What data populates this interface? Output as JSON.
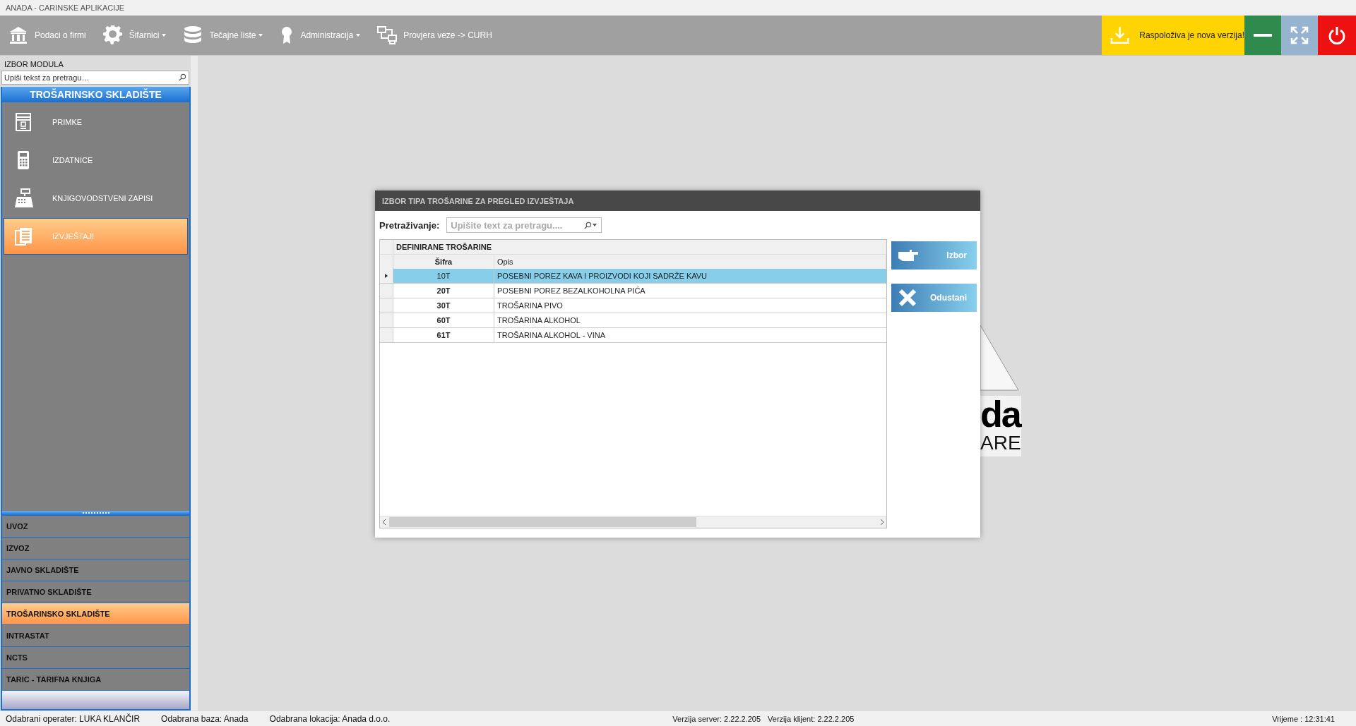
{
  "window": {
    "title": "ANADA - CARINSKE APLIKACIJE"
  },
  "toolbar": {
    "items": [
      {
        "label": "Podaci o firmi",
        "dropdown": false
      },
      {
        "label": "Šifarnici",
        "dropdown": true
      },
      {
        "label": "Tečajne liste",
        "dropdown": true
      },
      {
        "label": "Administracija",
        "dropdown": true
      },
      {
        "label": "Provjera veze -> CURH",
        "dropdown": false
      }
    ],
    "update_button": "Raspoloživa je nova verzija!"
  },
  "sidebar": {
    "header": "IZBOR MODULA",
    "search": {
      "placeholder": "Upiši tekst za pretragu…"
    },
    "module_title": "TROŠARINSKO SKLADIŠTE",
    "items": [
      {
        "label": "PRIMKE",
        "selected": false
      },
      {
        "label": "IZDATNICE",
        "selected": false
      },
      {
        "label": "KNJIGOVODSTVENI ZAPISI",
        "selected": false
      },
      {
        "label": "IZVJEŠTAJI",
        "selected": true
      }
    ],
    "modules": [
      {
        "label": "UVOZ",
        "selected": false
      },
      {
        "label": "IZVOZ",
        "selected": false
      },
      {
        "label": "JAVNO SKLADIŠTE",
        "selected": false
      },
      {
        "label": "PRIVATNO SKLADIŠTE",
        "selected": false
      },
      {
        "label": "TROŠARINSKO SKLADIŠTE",
        "selected": true
      },
      {
        "label": "INTRASTAT",
        "selected": false
      },
      {
        "label": "NCTS",
        "selected": false
      },
      {
        "label": "TARIC - TARIFNA KNJIGA",
        "selected": false
      }
    ]
  },
  "background_logo": {
    "texts": [
      "da",
      "ARE"
    ]
  },
  "dialog": {
    "title": "IZBOR TIPA TROŠARINE ZA PREGLED IZVJEŠTAJA",
    "search_label": "Pretraživanje:",
    "search": {
      "placeholder": "Upišite text za pretragu...."
    },
    "table": {
      "group": "DEFINIRANE TROŠARINE",
      "columns": [
        "Šifra",
        "Opis"
      ],
      "rows": [
        {
          "cells": [
            "10T",
            "POSEBNI POREZ KAVA I PROIZVODI KOJI SADRŽE KAVU"
          ],
          "selected": true
        },
        {
          "cells": [
            "20T",
            "POSEBNI POREZ BEZALKOHOLNA PIĆA"
          ],
          "selected": false
        },
        {
          "cells": [
            "30T",
            "TROŠARINA PIVO"
          ],
          "selected": false
        },
        {
          "cells": [
            "60T",
            "TROŠARINA ALKOHOL"
          ],
          "selected": false
        },
        {
          "cells": [
            "61T",
            "TROŠARINA ALKOHOL - VINA"
          ],
          "selected": false
        }
      ]
    },
    "buttons": [
      {
        "label": "Izbor",
        "kind": "select"
      },
      {
        "label": "Odustani",
        "kind": "cancel"
      }
    ]
  },
  "status_bar": {
    "left": [
      "Odabrani operater: LUKA KLANČIR",
      "Odabrana baza: Anada",
      "Odabrana lokacija: Anada d.o.o."
    ],
    "center": [
      "Verzija server: 2.22.2.205",
      "Verzija klijent: 2.22.2.205"
    ],
    "right": "Vrijeme : 12:31:41"
  }
}
